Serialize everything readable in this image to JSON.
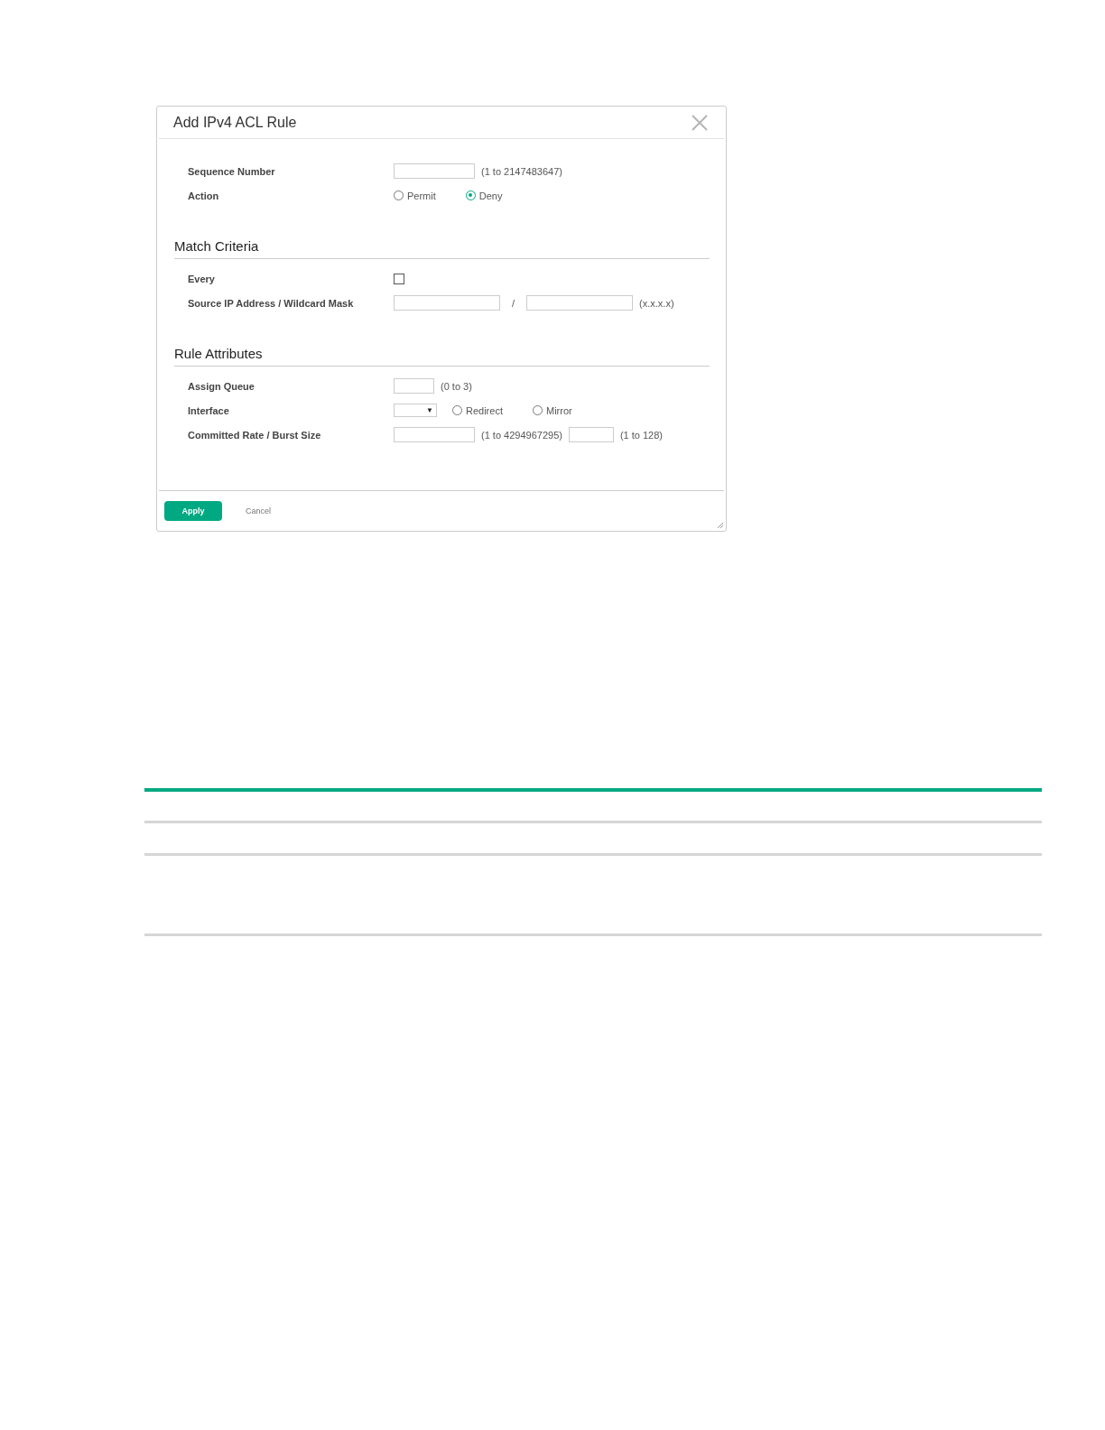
{
  "dialog": {
    "title": "Add IPv4 ACL Rule",
    "sections": [
      {
        "rows": [
          {
            "label": "Sequence Number",
            "controls": [
              {
                "kind": "field"
              },
              {
                "kind": "hint",
                "text": "(1 to 2147483647)"
              }
            ]
          },
          {
            "label": "Action",
            "controls": [
              {
                "kind": "radio",
                "text": "Permit",
                "selected": false
              },
              {
                "kind": "radio",
                "text": "Deny",
                "selected": true
              }
            ]
          }
        ]
      },
      {
        "heading": "Match Criteria",
        "rows": [
          {
            "label": "Every",
            "controls": [
              {
                "kind": "checkbox",
                "checked": false
              }
            ]
          },
          {
            "label": "Source IP Address / Wildcard Mask",
            "controls": [
              {
                "kind": "wide-field"
              },
              {
                "kind": "separator",
                "text": "/"
              },
              {
                "kind": "wide-field"
              },
              {
                "kind": "hint",
                "text": "(x.x.x.x)"
              }
            ]
          }
        ]
      },
      {
        "heading": "Rule Attributes",
        "rows": [
          {
            "label": "Assign Queue",
            "controls": [
              {
                "kind": "short-field"
              },
              {
                "kind": "hint",
                "text": "(0 to 3)"
              }
            ]
          },
          {
            "label": "Interface",
            "controls": [
              {
                "kind": "select",
                "text": "▼"
              },
              {
                "kind": "radio",
                "text": "Redirect",
                "selected": false
              },
              {
                "kind": "radio",
                "text": "Mirror",
                "selected": false
              }
            ]
          },
          {
            "label": "Committed Rate / Burst Size",
            "controls": [
              {
                "kind": "field"
              },
              {
                "kind": "hint",
                "text": "(1 to 4294967295)"
              },
              {
                "kind": "medium-field"
              },
              {
                "kind": "hint",
                "text": "(1 to 128)"
              }
            ]
          }
        ]
      }
    ],
    "buttons": [
      {
        "kind": "primary",
        "label": "Apply"
      },
      {
        "kind": "link",
        "label": "Cancel"
      }
    ]
  }
}
